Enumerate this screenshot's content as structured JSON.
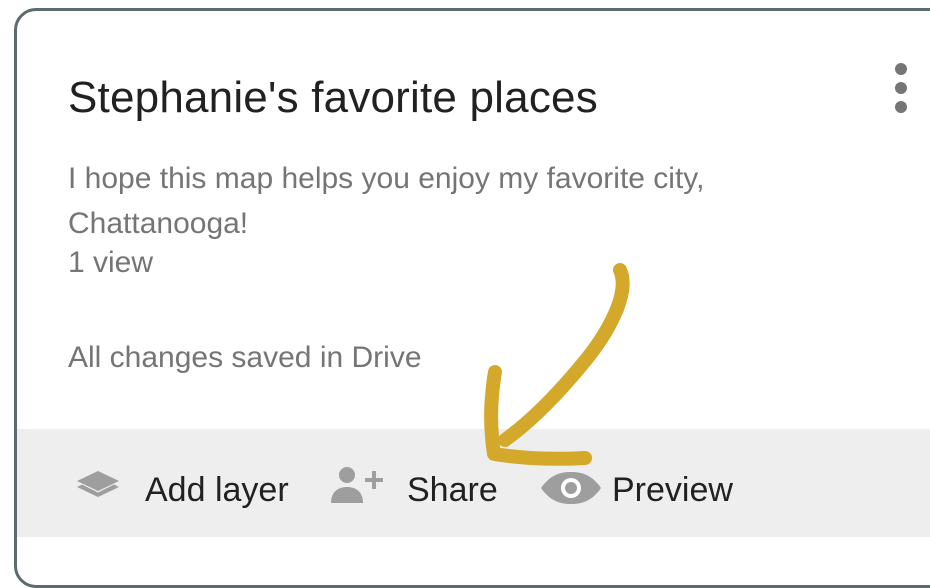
{
  "map": {
    "title": "Stephanie's favorite places",
    "description": "I hope this map helps you enjoy my favorite city, Chattanooga!",
    "views": "1 view",
    "save_status": "All changes saved in Drive"
  },
  "toolbar": {
    "add_layer_label": "Add layer",
    "share_label": "Share",
    "preview_label": "Preview"
  },
  "icons": {
    "menu": "more-vert-icon",
    "add_layer": "layers-icon",
    "share": "person-add-icon",
    "preview": "eye-icon",
    "annotation": "arrow-annotation"
  },
  "colors": {
    "title_text": "#212121",
    "secondary_text": "#757575",
    "toolbar_bg": "#eeeeee",
    "frame_border": "#5c6b6d",
    "arrow": "#d4a82a"
  }
}
